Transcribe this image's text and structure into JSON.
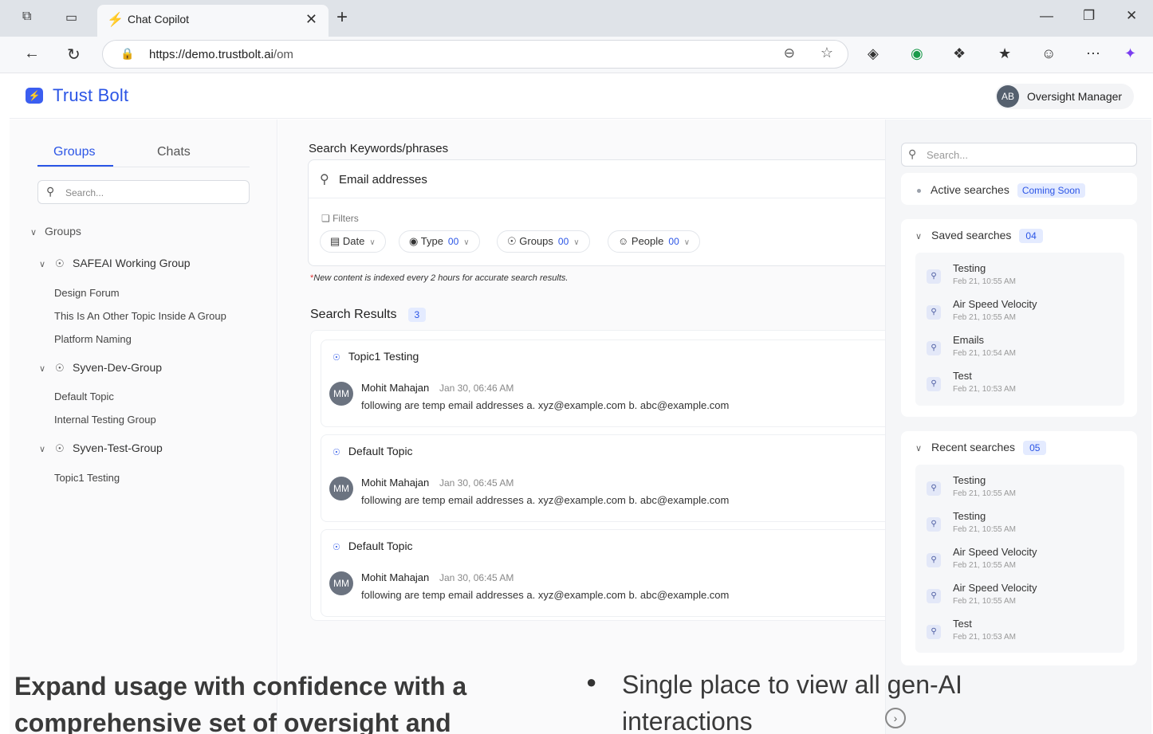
{
  "browser": {
    "tab_title": "Chat Copilot",
    "url_host": "https://demo.trustbolt.ai",
    "url_path": "/om"
  },
  "app": {
    "brand": "Trust Bolt",
    "user_initials": "AB",
    "user_role": "Oversight Manager"
  },
  "sidebar": {
    "tabs": [
      "Groups",
      "Chats"
    ],
    "active_tab": "Groups",
    "search_placeholder": "Search...",
    "tree_header": "Groups",
    "groups": [
      {
        "name": "SAFEAI Working Group",
        "topics": [
          "Design Forum",
          "This Is An Other Topic Inside A Group",
          "Platform Naming"
        ]
      },
      {
        "name": "Syven-Dev-Group",
        "topics": [
          "Default Topic",
          "Internal Testing Group"
        ]
      },
      {
        "name": "Syven-Test-Group",
        "topics": [
          "Topic1 Testing"
        ]
      }
    ]
  },
  "main": {
    "search_title": "Search Keywords/phrases",
    "search_value": "Email addresses",
    "filters_label": "Filters",
    "filters": [
      {
        "label": "Date",
        "count": ""
      },
      {
        "label": "Type",
        "count": "00"
      },
      {
        "label": "Groups",
        "count": "00"
      },
      {
        "label": "People",
        "count": "00"
      }
    ],
    "index_note": "New content is indexed every 2 hours for accurate search results.",
    "results_title": "Search Results",
    "results_count": "3",
    "results": [
      {
        "topic": "Topic1 Testing",
        "initials": "MM",
        "author": "Mohit Mahajan",
        "time": "Jan 30, 06:46 AM",
        "message": "following are temp email addresses a. xyz@example.com b. abc@example.com"
      },
      {
        "topic": "Default Topic",
        "initials": "MM",
        "author": "Mohit Mahajan",
        "time": "Jan 30, 06:45 AM",
        "message": "following are temp email addresses a. xyz@example.com b. abc@example.com"
      },
      {
        "topic": "Default Topic",
        "initials": "MM",
        "author": "Mohit Mahajan",
        "time": "Jan 30, 06:45 AM",
        "message": "following are temp email addresses a. xyz@example.com b. abc@example.com"
      }
    ]
  },
  "right": {
    "search_placeholder": "Search...",
    "active_label": "Active searches",
    "active_badge": "Coming Soon",
    "saved_label": "Saved searches",
    "saved_count": "04",
    "saved": [
      {
        "label": "Testing",
        "date": "Feb 21, 10:55 AM"
      },
      {
        "label": "Air Speed Velocity",
        "date": "Feb 21, 10:55 AM"
      },
      {
        "label": "Emails",
        "date": "Feb 21, 10:54 AM"
      },
      {
        "label": "Test",
        "date": "Feb 21, 10:53 AM"
      }
    ],
    "recent_label": "Recent searches",
    "recent_count": "05",
    "recent": [
      {
        "label": "Testing",
        "date": "Feb 21, 10:55 AM"
      },
      {
        "label": "Testing",
        "date": "Feb 21, 10:55 AM"
      },
      {
        "label": "Air Speed Velocity",
        "date": "Feb 21, 10:55 AM"
      },
      {
        "label": "Air Speed Velocity",
        "date": "Feb 21, 10:55 AM"
      },
      {
        "label": "Test",
        "date": "Feb 21, 10:53 AM"
      }
    ]
  },
  "overlay": {
    "left_text": "Expand usage with confidence with a comprehensive set of oversight and",
    "right_text": "Single place to view all gen-AI interactions"
  },
  "colors": {
    "accent": "#2b55e6",
    "badge_bg": "#e4ebff"
  }
}
